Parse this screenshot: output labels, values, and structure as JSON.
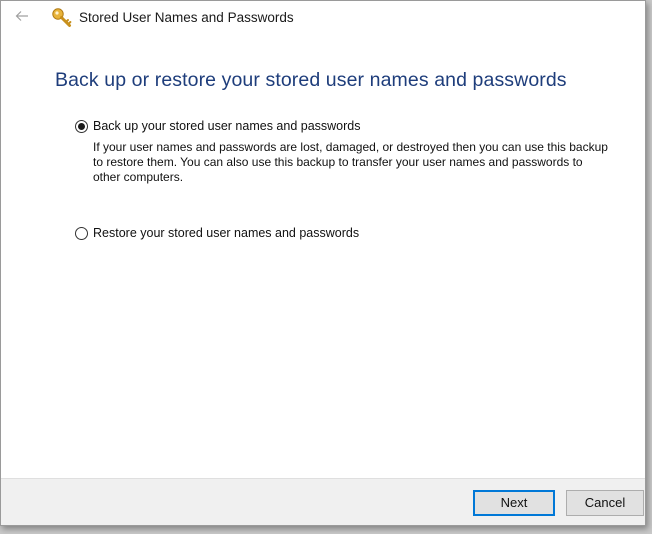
{
  "window": {
    "title": "Stored User Names and Passwords",
    "back_icon": "back-arrow-icon",
    "title_icon": "key-icon"
  },
  "main": {
    "heading": "Back up or restore your stored user names and passwords",
    "options": [
      {
        "label": "Back up your stored user names and passwords",
        "description": "If your user names and passwords are lost, damaged, or destroyed then you can use this backup to restore them. You can also use this backup to transfer your user names and passwords to other computers.",
        "selected": true
      },
      {
        "label": "Restore your stored user names and passwords",
        "selected": false
      }
    ]
  },
  "footer": {
    "next_label": "Next",
    "cancel_label": "Cancel"
  },
  "colors": {
    "heading": "#1e3d7b",
    "accent": "#0078d7",
    "footer_bg": "#f0f0f0"
  }
}
